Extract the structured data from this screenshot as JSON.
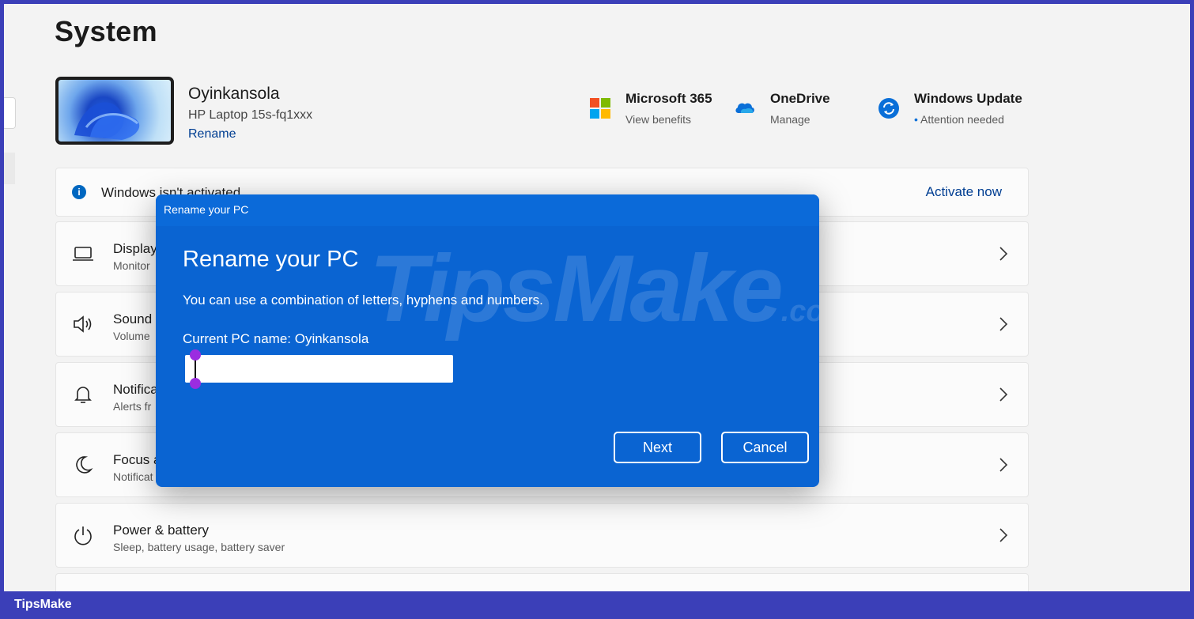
{
  "page": {
    "title": "System"
  },
  "device": {
    "name": "Oyinkansola",
    "model": "HP Laptop 15s-fq1xxx",
    "rename_label": "Rename"
  },
  "quick_links": [
    {
      "title": "Microsoft 365",
      "subtitle": "View benefits",
      "icon": "microsoft-logo-icon"
    },
    {
      "title": "OneDrive",
      "subtitle": "Manage",
      "icon": "onedrive-cloud-icon"
    },
    {
      "title": "Windows Update",
      "subtitle": "Attention needed",
      "icon": "windows-update-icon"
    }
  ],
  "banner": {
    "text": "Windows isn't activated",
    "action": "Activate now"
  },
  "settings": [
    {
      "title": "Display",
      "subtitle": "Monitor",
      "icon": "laptop-icon"
    },
    {
      "title": "Sound",
      "subtitle": "Volume",
      "icon": "speaker-icon"
    },
    {
      "title": "Notifica",
      "subtitle": "Alerts fr",
      "icon": "bell-icon"
    },
    {
      "title": "Focus a",
      "subtitle": "Notificat",
      "icon": "moon-icon"
    },
    {
      "title": "Power & battery",
      "subtitle": "Sleep, battery usage, battery saver",
      "icon": "power-icon"
    }
  ],
  "dialog": {
    "caption": "Rename your PC",
    "heading": "Rename your PC",
    "description": "You can use a combination of letters, hyphens and numbers.",
    "current_name": "Current PC name: Oyinkansola",
    "input_value": "",
    "next_label": "Next",
    "cancel_label": "Cancel"
  },
  "watermark": {
    "main": "TipsMake",
    "suffix": ".com"
  },
  "footer": {
    "brand": "TipsMake"
  },
  "colors": {
    "frame": "#3b3fb8",
    "dialog": "#0a64d2",
    "accent_link": "#003e92"
  }
}
